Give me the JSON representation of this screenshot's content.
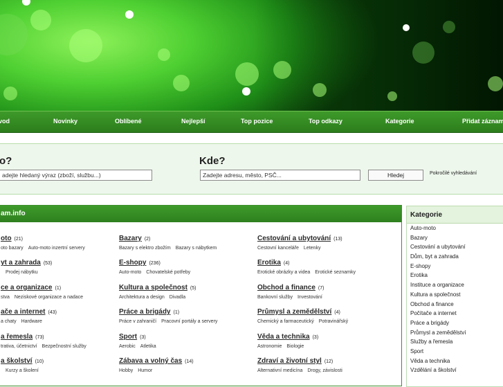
{
  "nav": {
    "items": [
      "vod",
      "Novinky",
      "Oblíbené",
      "Nejlepší",
      "Top pozice",
      "Top odkazy",
      "Kategorie",
      "Přidat záznam"
    ]
  },
  "search": {
    "what_label": "o?",
    "what_placeholder": "adejte hledaný výraz (zboží, službu...)",
    "where_label": "Kde?",
    "where_placeholder": "Zadejte adresu, město, PSČ...",
    "button_label": "Hledej",
    "advanced_link": "Pokročilé vyhledávání"
  },
  "main": {
    "title": "am.info",
    "columns": [
      [
        {
          "title": "oto",
          "count": "(21)",
          "subs": [
            "oto bazary",
            "Auto-moto inzertní servery"
          ]
        },
        {
          "title": "yt a zahrada",
          "count": "(53)",
          "subs": [
            "",
            "Prodej nábytku"
          ]
        },
        {
          "title": "ce a organizace",
          "count": "(1)",
          "subs": [
            "stva",
            "Neziskové organizace a nadace"
          ]
        },
        {
          "title": "ače a internet",
          "count": "(43)",
          "subs": [
            "a chaty",
            "Hardware"
          ]
        },
        {
          "title": "a řemesla",
          "count": "(73)",
          "subs": [
            "trativa, účetnictví",
            "Bezpečnostní služby"
          ]
        },
        {
          "title": "a školství",
          "count": "(10)",
          "subs": [
            "",
            "Kurzy a školení"
          ]
        }
      ],
      [
        {
          "title": "Bazary",
          "count": "(2)",
          "subs": [
            "Bazary s elektro zbožím",
            "Bazary s nábytkem"
          ]
        },
        {
          "title": "E-shopy",
          "count": "(236)",
          "subs": [
            "Auto-moto",
            "Chovatelské potřeby"
          ]
        },
        {
          "title": "Kultura a společnost",
          "count": "(5)",
          "subs": [
            "Architektura a design",
            "Divadla"
          ]
        },
        {
          "title": "Práce a brigády",
          "count": "(1)",
          "subs": [
            "Práce v zahraničí",
            "Pracovní portály a servery"
          ]
        },
        {
          "title": "Sport",
          "count": "(3)",
          "subs": [
            "Aerobic",
            "Atletika"
          ]
        },
        {
          "title": "Zábava a volný čas",
          "count": "(14)",
          "subs": [
            "Hobby",
            "Humor"
          ]
        }
      ],
      [
        {
          "title": "Cestování a ubytování",
          "count": "(13)",
          "subs": [
            "Cestovní kanceláře",
            "Letenky"
          ]
        },
        {
          "title": "Erotika",
          "count": "(4)",
          "subs": [
            "Erotické obrázky a videa",
            "Erotické seznamky"
          ]
        },
        {
          "title": "Obchod a finance",
          "count": "(7)",
          "subs": [
            "Bankovní služby",
            "Investování"
          ]
        },
        {
          "title": "Průmysl a zemědělství",
          "count": "(4)",
          "subs": [
            "Chemický a farmaceutický",
            "Potravinářský"
          ]
        },
        {
          "title": "Věda a technika",
          "count": "(3)",
          "subs": [
            "Astronomie",
            "Biologie"
          ]
        },
        {
          "title": "Zdraví a životní styl",
          "count": "(12)",
          "subs": [
            "Alternativní medicína",
            "Drogy, závislosti"
          ]
        }
      ]
    ]
  },
  "sidebar": {
    "title": "Kategorie",
    "items": [
      "Auto-moto",
      "Bazary",
      "Cestování a ubytování",
      "Dům, byt a zahrada",
      "E-shopy",
      "Erotika",
      "Instituce a organizace",
      "Kultura a společnost",
      "Obchod a finance",
      "Počítače a internet",
      "Práce a brigády",
      "Průmysl a zemědělství",
      "Služby a řemesla",
      "Sport",
      "Věda a technika",
      "Vzdělání a školství"
    ]
  },
  "colors": {
    "accent": "#3e9a2a",
    "panel": "#eef7ec"
  }
}
